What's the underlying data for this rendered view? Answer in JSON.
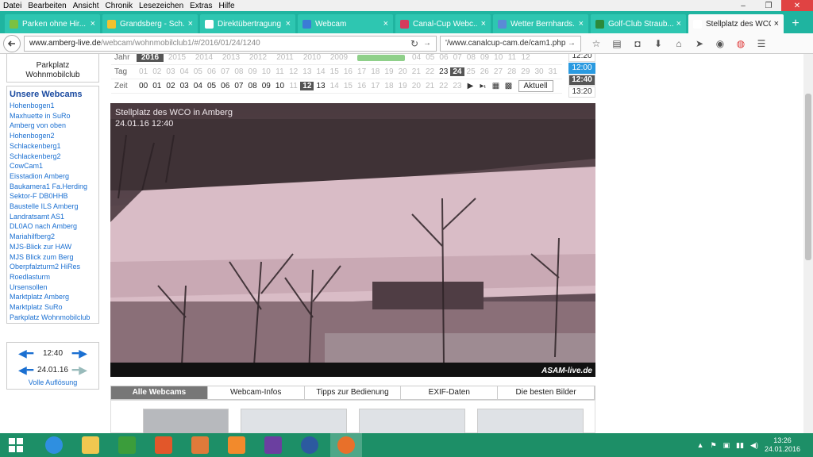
{
  "menu": [
    "Datei",
    "Bearbeiten",
    "Ansicht",
    "Chronik",
    "Lesezeichen",
    "Extras",
    "Hilfe"
  ],
  "window_controls": {
    "minimize": "–",
    "maximize": "❐",
    "close": "✕"
  },
  "tabs": [
    {
      "label": "Parken ohne Hir...",
      "icon_color": "#7cc142"
    },
    {
      "label": "Grandsberg - Sch...",
      "icon_color": "#f2c230"
    },
    {
      "label": "Direktübertragung - ...",
      "icon_color": "#ffffff"
    },
    {
      "label": "Webcam",
      "icon_color": "#3b7bd6"
    },
    {
      "label": "Canal-Cup Webc...",
      "icon_color": "#d63b5c"
    },
    {
      "label": "Wetter Bernhards...",
      "icon_color": "#5a8bd6"
    },
    {
      "label": "Golf-Club Straub...",
      "icon_color": "#2c8a3a"
    },
    {
      "label": "Stellplatz des WCO in...",
      "icon_color": "#ffffff",
      "active": true
    }
  ],
  "new_tab": "+",
  "url": {
    "domain": "www.amberg-live.de",
    "path": "/webcam/wohnmobilclub1/#/2016/01/24/1240"
  },
  "search_box": "'/www.canalcup-cam.de/cam1.php",
  "sidebar": {
    "park_title_1": "Parkplatz",
    "park_title_2": "Wohnmobilclub",
    "heading": "Unsere Webcams",
    "cams": [
      "Hohenbogen1",
      "Maxhuette in SuRo",
      "Amberg von oben",
      "Hohenbogen2",
      "Schlackenberg1",
      "Schlackenberg2",
      "CowCam1",
      "Eisstadion Amberg",
      "Baukamera1 Fa.Herding",
      "Sektor-F DB0HHB",
      "Baustelle ILS Amberg",
      "Landratsamt AS1",
      "DL0AO nach Amberg",
      "Mariahilfberg2",
      "MJS-Blick zur HAW",
      "MJS Blick zum Berg",
      "Oberpfalzturm2 HiRes",
      "Roedlasturm",
      "Ursensollen",
      "Marktplatz Amberg",
      "Marktplatz SuRo",
      "Parkplatz Wohnmobilclub"
    ],
    "time": "12:40",
    "date": "24.01.16",
    "full_res": "Volle Auflösung"
  },
  "grid": {
    "year_label": "Jahr",
    "years": [
      "2016",
      "2015",
      "2014",
      "2013",
      "2012",
      "2011",
      "2010",
      "2009"
    ],
    "year_tail": [
      "04",
      "05",
      "06",
      "07",
      "08",
      "09",
      "10",
      "11",
      "12"
    ],
    "day_label": "Tag",
    "days": [
      "01",
      "02",
      "03",
      "04",
      "05",
      "06",
      "07",
      "08",
      "09",
      "10",
      "11",
      "12",
      "13",
      "14",
      "15",
      "16",
      "17",
      "18",
      "19",
      "20",
      "21",
      "22",
      "23",
      "24",
      "25",
      "26",
      "27",
      "28",
      "29",
      "30",
      "31"
    ],
    "selected_day": "24",
    "time_label": "Zeit",
    "hours": [
      "00",
      "01",
      "02",
      "03",
      "04",
      "05",
      "06",
      "07",
      "08",
      "09",
      "10",
      "11",
      "12",
      "13",
      "14",
      "15",
      "16",
      "17",
      "18",
      "19",
      "20",
      "21",
      "22",
      "23"
    ],
    "selected_hour": "12",
    "current_button": "Aktuell"
  },
  "times_list": [
    {
      "t": "12:20",
      "style": "plain"
    },
    {
      "t": "12:00",
      "style": "blue"
    },
    {
      "t": "12:40",
      "style": "dark"
    },
    {
      "t": "13:20",
      "style": "plain"
    }
  ],
  "webcam": {
    "caption_1": "Stellplatz des WCO in Amberg",
    "caption_2": "24.01.16 12:40",
    "logo": "ASAM-live.de"
  },
  "lower_tabs": [
    "Alle Webcams",
    "Webcam-Infos",
    "Tipps zur Bedienung",
    "EXIF-Daten",
    "Die besten Bilder"
  ],
  "clock": {
    "time": "13:26",
    "date": "24.01.2016"
  },
  "colors": {
    "tabstrip": "#1fb4a0",
    "taskbar": "#1d8f67",
    "link": "#1a6fd1",
    "selected": "#555555"
  }
}
